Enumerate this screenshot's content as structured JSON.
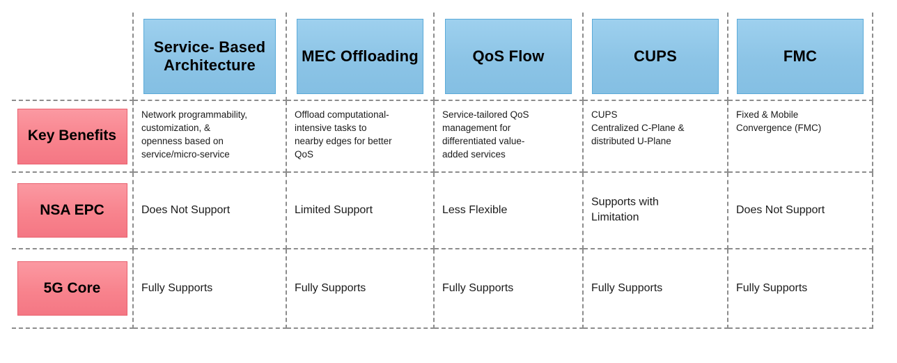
{
  "table": {
    "corner_label": "",
    "columns": [
      {
        "id": "service-based-architecture",
        "label": "Service-\nBased\nArchitecture"
      },
      {
        "id": "mec-offloading",
        "label": "MEC\nOffloading"
      },
      {
        "id": "qos-flow",
        "label": "QoS Flow"
      },
      {
        "id": "cups",
        "label": "CUPS"
      },
      {
        "id": "fmc",
        "label": "FMC"
      }
    ],
    "rows": [
      {
        "id": "key-benefits",
        "label": "Key\nBenefits",
        "style": "paragraph",
        "cells": [
          "Network programmability,\ncustomization, &\nopenness based on\nservice/micro-service",
          "Offload computational-\nintensive tasks to\nnearby edges for better\nQoS",
          "Service-tailored QoS\nmanagement for\ndifferentiated value-\nadded services",
          "CUPS\nCentralized C-Plane &\ndistributed U-Plane",
          "Fixed & Mobile\nConvergence (FMC)"
        ]
      },
      {
        "id": "nsa-epc",
        "label": "NSA EPC",
        "style": "centered",
        "cells": [
          "Does Not Support",
          "Limited Support",
          "Less Flexible",
          "Supports with\nLimitation",
          "Does Not Support"
        ]
      },
      {
        "id": "5g-core",
        "label": "5G Core",
        "style": "centered",
        "cells": [
          "Fully Supports",
          "Fully Supports",
          "Fully Supports",
          "Fully Supports",
          "Fully Supports"
        ]
      }
    ]
  },
  "colors": {
    "column_header_fill": "#8cc4e6",
    "column_header_border": "#5aaad8",
    "row_header_fill": "#f8838d",
    "row_header_border": "#e8606e",
    "grid_line": "#8c8c8c",
    "text": "#1a1a1a",
    "background": "#ffffff"
  }
}
